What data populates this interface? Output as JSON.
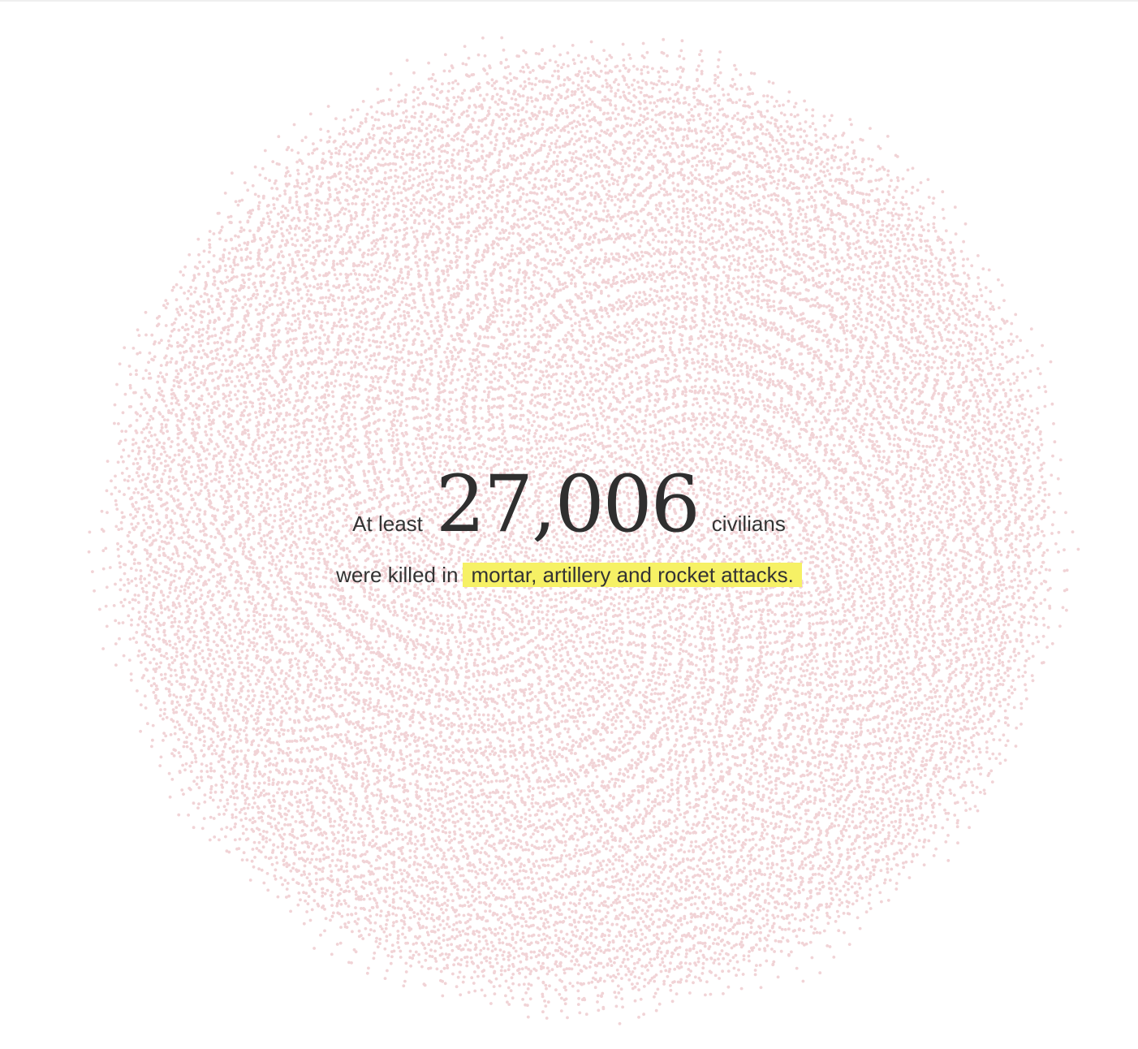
{
  "headline": {
    "prefix": "At least",
    "count": "27,006",
    "suffix": "civilians",
    "line2_prefix": "were killed in",
    "line2_highlight": "mortar, artillery and rocket attacks."
  },
  "colors": {
    "dot": "#f1d3d6",
    "highlight": "#f6f165",
    "text": "#333333"
  },
  "dots": {
    "count": 27006
  }
}
